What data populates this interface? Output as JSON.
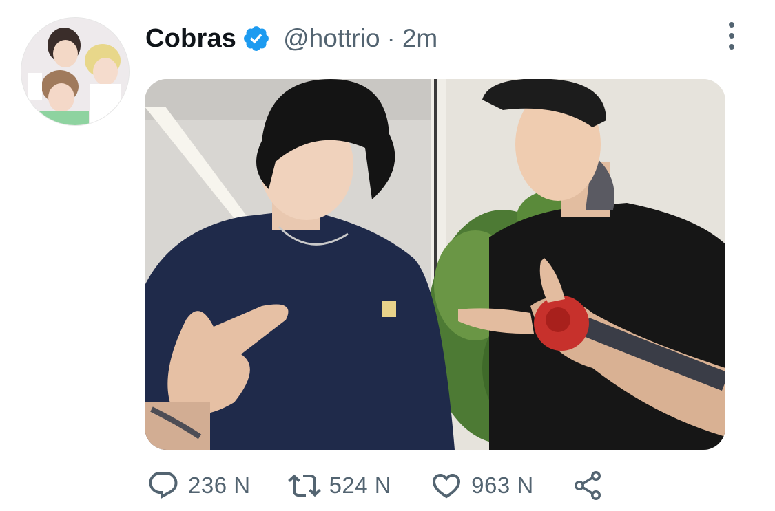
{
  "tweet": {
    "display_name": "Cobras",
    "handle": "@hottrio",
    "separator": "·",
    "time": "2m",
    "avatar_icon": "avatar-group-photo",
    "verified_icon": "verified-badge-icon",
    "more_icon": "more-vertical-icon",
    "media_description_icon": "tweet-photo"
  },
  "actions": {
    "reply": {
      "icon": "reply-icon",
      "count": "236 N"
    },
    "retweet": {
      "icon": "retweet-icon",
      "count": "524 N"
    },
    "like": {
      "icon": "heart-icon",
      "count": "963 N"
    },
    "share": {
      "icon": "share-icon"
    }
  },
  "colors": {
    "text_primary": "#0f1419",
    "text_secondary": "#536471",
    "verified_blue": "#1d9bf0",
    "background": "#ffffff"
  }
}
